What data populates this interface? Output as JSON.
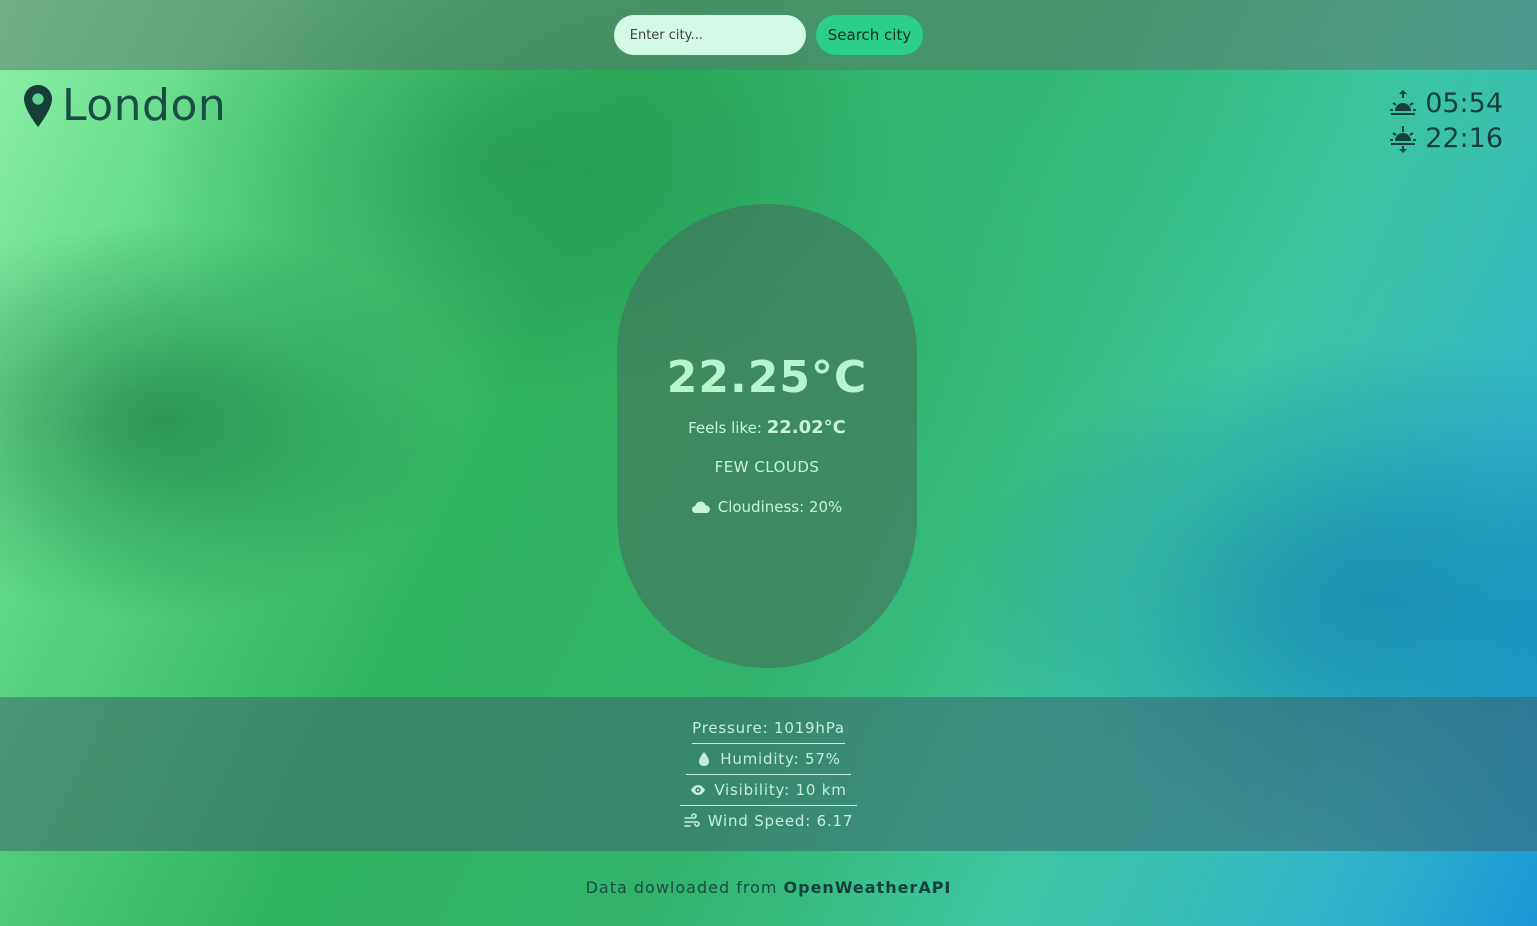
{
  "search": {
    "placeholder": "Enter city...",
    "button_label": "Search city"
  },
  "location": {
    "city": "London",
    "icon": "map-pin-icon"
  },
  "sun": {
    "sunrise": "05:54",
    "sunset": "22:16"
  },
  "weather": {
    "temperature": "22.25°C",
    "feels_like_label": "Feels like:",
    "feels_like_value": "22.02°C",
    "description": "FEW CLOUDS",
    "cloudiness": "Cloudiness: 20%"
  },
  "details": {
    "pressure": "Pressure: 1019hPa",
    "humidity": "Humidity: 57%",
    "visibility": "Visibility: 10 km",
    "wind_speed": "Wind Speed: 6.17"
  },
  "footer": {
    "text": "Data dowloaded from ",
    "link": "OpenWeatherAPI"
  },
  "colors": {
    "accent": "#2ccf8a",
    "input_bg": "#d3f9e7",
    "text_light": "#c3efdc"
  }
}
